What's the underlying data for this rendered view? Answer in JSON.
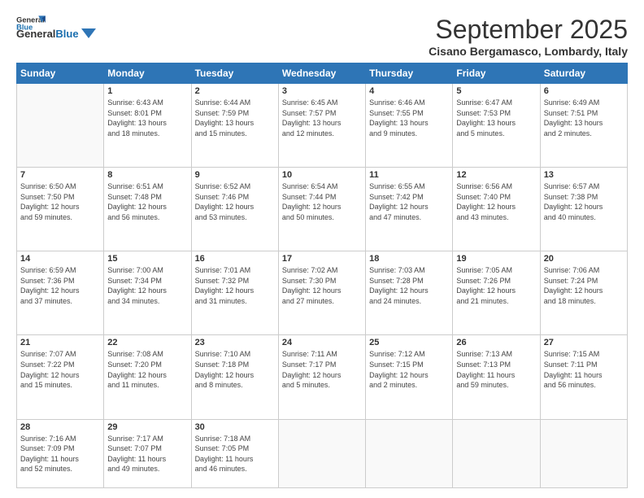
{
  "header": {
    "logo_line1": "General",
    "logo_line2": "Blue",
    "month_title": "September 2025",
    "location": "Cisano Bergamasco, Lombardy, Italy"
  },
  "weekdays": [
    "Sunday",
    "Monday",
    "Tuesday",
    "Wednesday",
    "Thursday",
    "Friday",
    "Saturday"
  ],
  "weeks": [
    [
      {
        "day": "",
        "info": ""
      },
      {
        "day": "1",
        "info": "Sunrise: 6:43 AM\nSunset: 8:01 PM\nDaylight: 13 hours\nand 18 minutes."
      },
      {
        "day": "2",
        "info": "Sunrise: 6:44 AM\nSunset: 7:59 PM\nDaylight: 13 hours\nand 15 minutes."
      },
      {
        "day": "3",
        "info": "Sunrise: 6:45 AM\nSunset: 7:57 PM\nDaylight: 13 hours\nand 12 minutes."
      },
      {
        "day": "4",
        "info": "Sunrise: 6:46 AM\nSunset: 7:55 PM\nDaylight: 13 hours\nand 9 minutes."
      },
      {
        "day": "5",
        "info": "Sunrise: 6:47 AM\nSunset: 7:53 PM\nDaylight: 13 hours\nand 5 minutes."
      },
      {
        "day": "6",
        "info": "Sunrise: 6:49 AM\nSunset: 7:51 PM\nDaylight: 13 hours\nand 2 minutes."
      }
    ],
    [
      {
        "day": "7",
        "info": "Sunrise: 6:50 AM\nSunset: 7:50 PM\nDaylight: 12 hours\nand 59 minutes."
      },
      {
        "day": "8",
        "info": "Sunrise: 6:51 AM\nSunset: 7:48 PM\nDaylight: 12 hours\nand 56 minutes."
      },
      {
        "day": "9",
        "info": "Sunrise: 6:52 AM\nSunset: 7:46 PM\nDaylight: 12 hours\nand 53 minutes."
      },
      {
        "day": "10",
        "info": "Sunrise: 6:54 AM\nSunset: 7:44 PM\nDaylight: 12 hours\nand 50 minutes."
      },
      {
        "day": "11",
        "info": "Sunrise: 6:55 AM\nSunset: 7:42 PM\nDaylight: 12 hours\nand 47 minutes."
      },
      {
        "day": "12",
        "info": "Sunrise: 6:56 AM\nSunset: 7:40 PM\nDaylight: 12 hours\nand 43 minutes."
      },
      {
        "day": "13",
        "info": "Sunrise: 6:57 AM\nSunset: 7:38 PM\nDaylight: 12 hours\nand 40 minutes."
      }
    ],
    [
      {
        "day": "14",
        "info": "Sunrise: 6:59 AM\nSunset: 7:36 PM\nDaylight: 12 hours\nand 37 minutes."
      },
      {
        "day": "15",
        "info": "Sunrise: 7:00 AM\nSunset: 7:34 PM\nDaylight: 12 hours\nand 34 minutes."
      },
      {
        "day": "16",
        "info": "Sunrise: 7:01 AM\nSunset: 7:32 PM\nDaylight: 12 hours\nand 31 minutes."
      },
      {
        "day": "17",
        "info": "Sunrise: 7:02 AM\nSunset: 7:30 PM\nDaylight: 12 hours\nand 27 minutes."
      },
      {
        "day": "18",
        "info": "Sunrise: 7:03 AM\nSunset: 7:28 PM\nDaylight: 12 hours\nand 24 minutes."
      },
      {
        "day": "19",
        "info": "Sunrise: 7:05 AM\nSunset: 7:26 PM\nDaylight: 12 hours\nand 21 minutes."
      },
      {
        "day": "20",
        "info": "Sunrise: 7:06 AM\nSunset: 7:24 PM\nDaylight: 12 hours\nand 18 minutes."
      }
    ],
    [
      {
        "day": "21",
        "info": "Sunrise: 7:07 AM\nSunset: 7:22 PM\nDaylight: 12 hours\nand 15 minutes."
      },
      {
        "day": "22",
        "info": "Sunrise: 7:08 AM\nSunset: 7:20 PM\nDaylight: 12 hours\nand 11 minutes."
      },
      {
        "day": "23",
        "info": "Sunrise: 7:10 AM\nSunset: 7:18 PM\nDaylight: 12 hours\nand 8 minutes."
      },
      {
        "day": "24",
        "info": "Sunrise: 7:11 AM\nSunset: 7:17 PM\nDaylight: 12 hours\nand 5 minutes."
      },
      {
        "day": "25",
        "info": "Sunrise: 7:12 AM\nSunset: 7:15 PM\nDaylight: 12 hours\nand 2 minutes."
      },
      {
        "day": "26",
        "info": "Sunrise: 7:13 AM\nSunset: 7:13 PM\nDaylight: 11 hours\nand 59 minutes."
      },
      {
        "day": "27",
        "info": "Sunrise: 7:15 AM\nSunset: 7:11 PM\nDaylight: 11 hours\nand 56 minutes."
      }
    ],
    [
      {
        "day": "28",
        "info": "Sunrise: 7:16 AM\nSunset: 7:09 PM\nDaylight: 11 hours\nand 52 minutes."
      },
      {
        "day": "29",
        "info": "Sunrise: 7:17 AM\nSunset: 7:07 PM\nDaylight: 11 hours\nand 49 minutes."
      },
      {
        "day": "30",
        "info": "Sunrise: 7:18 AM\nSunset: 7:05 PM\nDaylight: 11 hours\nand 46 minutes."
      },
      {
        "day": "",
        "info": ""
      },
      {
        "day": "",
        "info": ""
      },
      {
        "day": "",
        "info": ""
      },
      {
        "day": "",
        "info": ""
      }
    ]
  ]
}
